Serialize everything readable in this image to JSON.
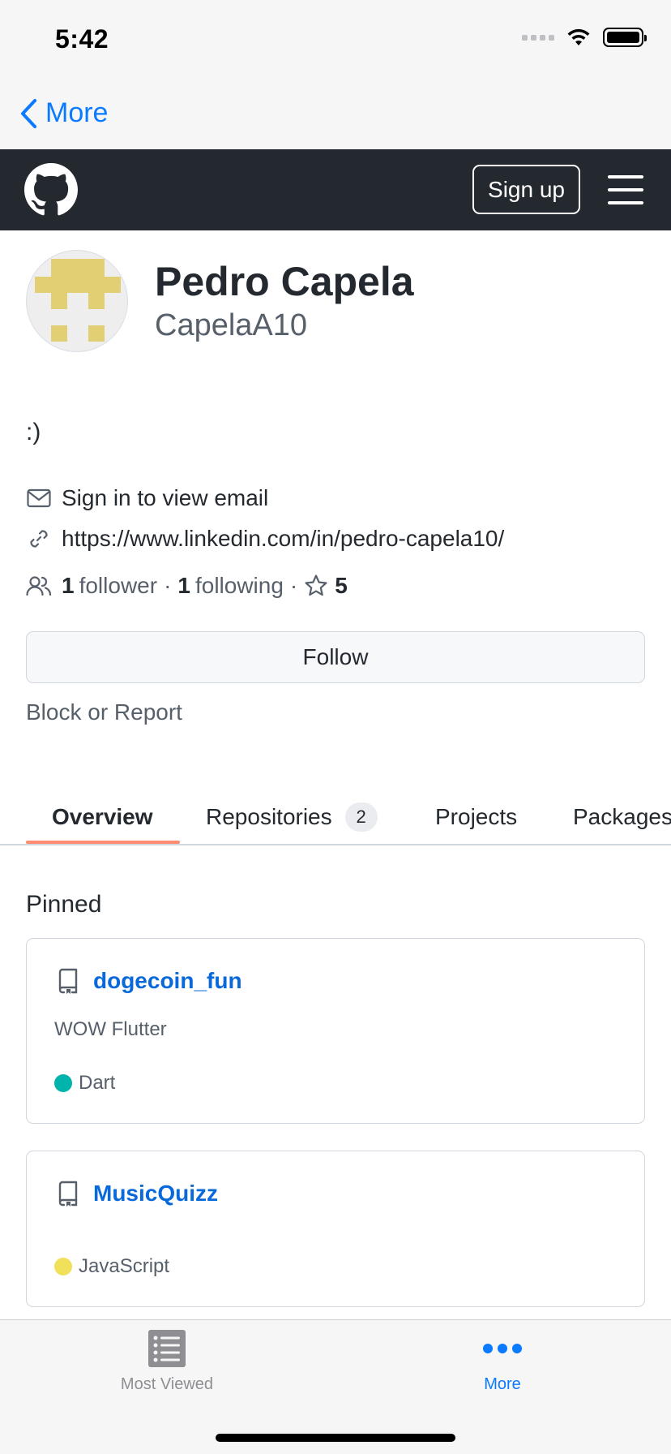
{
  "status_bar": {
    "time": "5:42"
  },
  "nav": {
    "back_label": "More"
  },
  "header": {
    "signup_label": "Sign up"
  },
  "profile": {
    "name": "Pedro Capela",
    "login": "CapelaA10",
    "bio": ":)",
    "email_text": "Sign in to view email",
    "website": "https://www.linkedin.com/in/pedro-capela10/",
    "followers_count": "1",
    "followers_label": "follower",
    "following_count": "1",
    "following_label": "following",
    "stars_count": "5",
    "follow_label": "Follow",
    "block_label": "Block or Report"
  },
  "tabs": [
    {
      "label": "Overview",
      "active": true
    },
    {
      "label": "Repositories",
      "count": "2"
    },
    {
      "label": "Projects"
    },
    {
      "label": "Packages"
    }
  ],
  "pinned": {
    "title": "Pinned",
    "repos": [
      {
        "name": "dogecoin_fun",
        "description": "WOW Flutter",
        "language": "Dart",
        "language_color": "#00B4AB"
      },
      {
        "name": "MusicQuizz",
        "description": "",
        "language": "JavaScript",
        "language_color": "#f1e05a"
      }
    ]
  },
  "tabbar": [
    {
      "label": "Most Viewed",
      "icon": "list-icon"
    },
    {
      "label": "More",
      "icon": "more-icon",
      "active": true
    }
  ],
  "colors": {
    "ios_blue": "#0a7aff",
    "gh_header": "#24292f",
    "link_blue": "#0969da",
    "tab_underline": "#fd8c73",
    "identicon": "#e2cf73"
  }
}
